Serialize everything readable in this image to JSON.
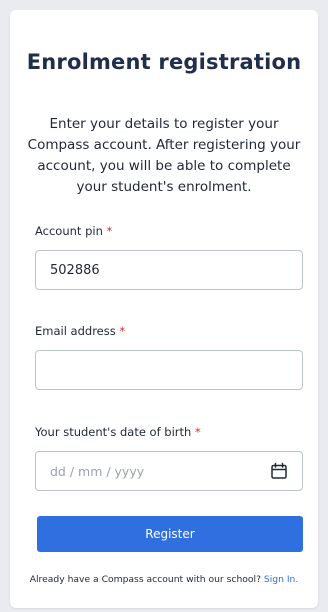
{
  "form": {
    "title": "Enrolment registration",
    "description": "Enter your details to register your Compass account. After registering your account, you will be able to complete your student's enrolment.",
    "required_marker": "*",
    "pin": {
      "label": "Account pin",
      "value": "502886"
    },
    "email": {
      "label": "Email address",
      "value": "",
      "placeholder": ""
    },
    "dob": {
      "label": "Your student's date of birth",
      "placeholder": "dd / mm / yyyy"
    },
    "register_label": "Register",
    "footer_text": "Already have a Compass account with our school?",
    "signin_label": "Sign In."
  },
  "colors": {
    "accent": "#2f6fe0",
    "required": "#d62b2b",
    "title": "#1f2e4a"
  },
  "icons": {
    "dob_icon": "calendar-icon"
  }
}
